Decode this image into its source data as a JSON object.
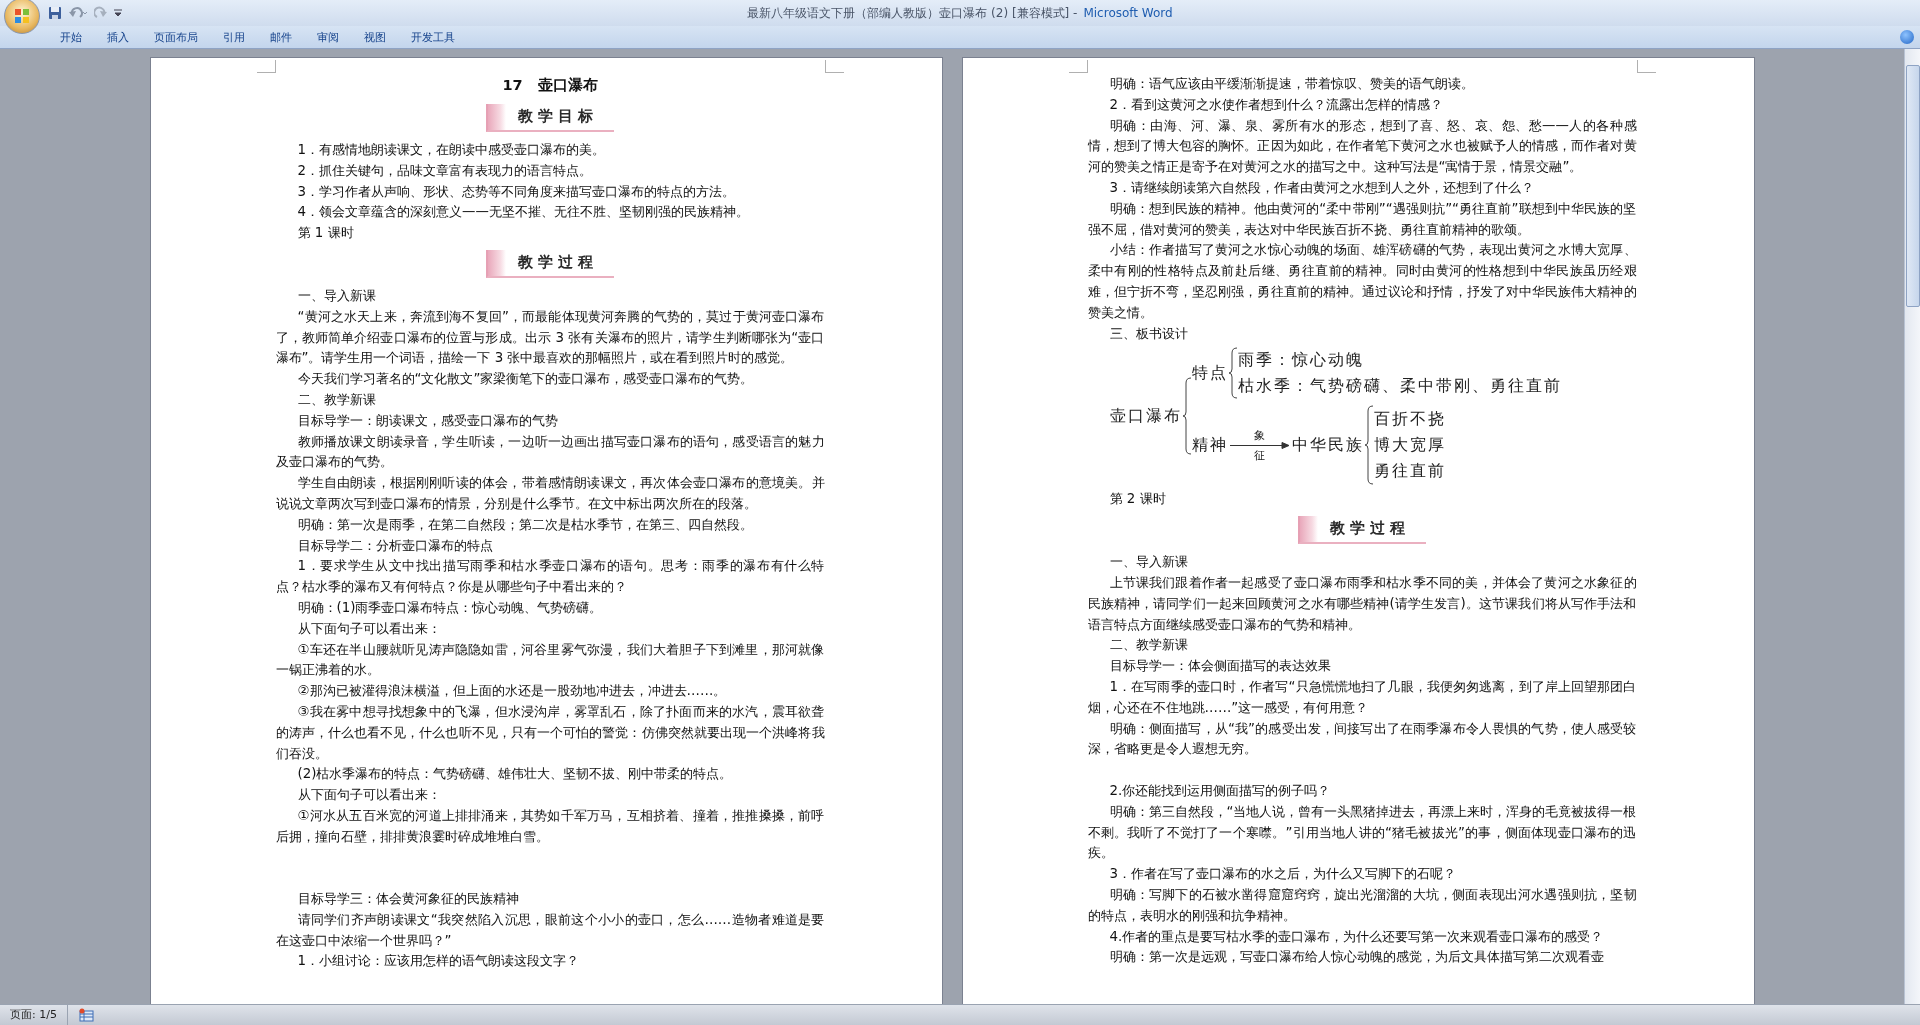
{
  "window": {
    "title": "最新八年级语文下册（部编人教版）壶口瀑布 (2) [兼容模式] -",
    "app_name": "Microsoft Word"
  },
  "ribbon_tabs": [
    {
      "label": "开始",
      "selected": false
    },
    {
      "label": "插入",
      "selected": false
    },
    {
      "label": "页面布局",
      "selected": false
    },
    {
      "label": "引用",
      "selected": false
    },
    {
      "label": "邮件",
      "selected": false
    },
    {
      "label": "审阅",
      "selected": false
    },
    {
      "label": "视图",
      "selected": false
    },
    {
      "label": "开发工具",
      "selected": false
    }
  ],
  "pages": [
    {
      "blocks": [
        {
          "kind": "title",
          "text": "17　壶口瀑布"
        },
        {
          "kind": "banner",
          "text": "教学目标"
        },
        {
          "kind": "para",
          "text": "1．有感情地朗读课文，在朗读中感受壶口瀑布的美。"
        },
        {
          "kind": "para",
          "text": "2．抓住关键句，品味文章富有表现力的语言特点。"
        },
        {
          "kind": "para",
          "text": "3．学习作者从声响、形状、态势等不同角度来描写壶口瀑布的特点的方法。"
        },
        {
          "kind": "para",
          "text": "4．领会文章蕴含的深刻意义——无坚不摧、无往不胜、坚韧刚强的民族精神。"
        },
        {
          "kind": "para",
          "text": "第 1 课时"
        },
        {
          "kind": "banner",
          "text": "教学过程"
        },
        {
          "kind": "para",
          "text": "一、导入新课"
        },
        {
          "kind": "para",
          "text": "“黄河之水天上来，奔流到海不复回”，而最能体现黄河奔腾的气势的，莫过于黄河壶口瀑布了，教师简单介绍壶口瀑布的位置与形成。出示 3 张有关瀑布的照片，请学生判断哪张为“壶口瀑布”。请学生用一个词语，描绘一下 3 张中最喜欢的那幅照片，或在看到照片时的感觉。"
        },
        {
          "kind": "para",
          "text": "今天我们学习著名的“文化散文”家梁衡笔下的壶口瀑布，感受壶口瀑布的气势。"
        },
        {
          "kind": "para",
          "text": "二、教学新课"
        },
        {
          "kind": "para",
          "text": "目标导学一：朗读课文，感受壶口瀑布的气势"
        },
        {
          "kind": "para",
          "text": "教师播放课文朗读录音，学生听读，一边听一边画出描写壶口瀑布的语句，感受语言的魅力及壶口瀑布的气势。"
        },
        {
          "kind": "para",
          "text": "学生自由朗读，根据刚刚听读的体会，带着感情朗读课文，再次体会壶口瀑布的意境美。并说说文章两次写到壶口瀑布的情景，分别是什么季节。在文中标出两次所在的段落。"
        },
        {
          "kind": "para",
          "text": "明确：第一次是雨季，在第二自然段；第二次是枯水季节，在第三、四自然段。"
        },
        {
          "kind": "para",
          "text": "目标导学二：分析壶口瀑布的特点"
        },
        {
          "kind": "para",
          "text": "1．要求学生从文中找出描写雨季和枯水季壶口瀑布的语句。思考：雨季的瀑布有什么特点？枯水季的瀑布又有何特点？你是从哪些句子中看出来的？"
        },
        {
          "kind": "para",
          "text": "明确：(1)雨季壶口瀑布特点：惊心动魄、气势磅礴。"
        },
        {
          "kind": "para",
          "text": "从下面句子可以看出来："
        },
        {
          "kind": "para",
          "text": "①车还在半山腰就听见涛声隐隐如雷，河谷里雾气弥漫，我们大着胆子下到滩里，那河就像一锅正沸着的水。"
        },
        {
          "kind": "para",
          "text": "②那沟已被灌得浪沫横溢，但上面的水还是一股劲地冲进去，冲进去……。"
        },
        {
          "kind": "para",
          "text": "③我在雾中想寻找想象中的飞瀑，但水浸沟岸，雾罩乱石，除了扑面而来的水汽，震耳欲聋的涛声，什么也看不见，什么也听不见，只有一个可怕的警觉：仿佛突然就要出现一个洪峰将我们吞没。"
        },
        {
          "kind": "para",
          "text": "(2)枯水季瀑布的特点：气势磅礴、雄伟壮大、坚韧不拔、刚中带柔的特点。"
        },
        {
          "kind": "para",
          "text": "从下面句子可以看出来："
        },
        {
          "kind": "para",
          "text": "①河水从五百米宽的河道上排排涌来，其势如千军万马，互相挤着、撞着，推推搡搡，前呼后拥，撞向石壁，排排黄浪霎时碎成堆堆白雪。"
        },
        {
          "kind": "blank"
        },
        {
          "kind": "blank"
        },
        {
          "kind": "para",
          "text": "目标导学三：体会黄河象征的民族精神"
        },
        {
          "kind": "para",
          "text": "请同学们齐声朗读课文“我突然陷入沉思，眼前这个小小的壶口，怎么……造物者难道是要在这壶口中浓缩一个世界吗？”"
        },
        {
          "kind": "para",
          "text": "1．小组讨论：应该用怎样的语气朗读这段文字？"
        }
      ]
    },
    {
      "blocks": [
        {
          "kind": "para",
          "text": "明确：语气应该由平缓渐渐提速，带着惊叹、赞美的语气朗读。"
        },
        {
          "kind": "para",
          "text": "2．看到这黄河之水使作者想到什么？流露出怎样的情感？"
        },
        {
          "kind": "para",
          "text": "明确：由海、河、瀑、泉、雾所有水的形态，想到了喜、怒、哀、怨、愁——人的各种感情，想到了博大包容的胸怀。正因为如此，在作者笔下黄河之水也被赋予人的情感，而作者对黄河的赞美之情正是寄予在对黄河之水的描写之中。这种写法是“寓情于景，情景交融”。"
        },
        {
          "kind": "para",
          "text": "3．请继续朗读第六自然段，作者由黄河之水想到人之外，还想到了什么？"
        },
        {
          "kind": "para",
          "text": "明确：想到民族的精神。他由黄河的“柔中带刚”“遇强则抗”“勇往直前”联想到中华民族的坚强不屈，借对黄河的赞美，表达对中华民族百折不挠、勇往直前精神的歌颂。"
        },
        {
          "kind": "para",
          "text": "小结：作者描写了黄河之水惊心动魄的场面、雄浑磅礴的气势，表现出黄河之水博大宽厚、柔中有刚的性格特点及前赴后继、勇往直前的精神。同时由黄河的性格想到中华民族虽历经艰难，但宁折不弯，坚忍刚强，勇往直前的精神。通过议论和抒情，抒发了对中华民族伟大精神的赞美之情。"
        },
        {
          "kind": "para",
          "text": "三、板书设计"
        },
        {
          "kind": "diagram",
          "root": "壶口瀑布",
          "features": {
            "label": "特点",
            "items": [
              "雨季：惊心动魄",
              "枯水季：气势磅礴、柔中带刚、勇往直前"
            ]
          },
          "spirit": {
            "label": "精神",
            "arrow_top": "象",
            "arrow_bottom": "征",
            "target": "中华民族",
            "items": [
              "百折不挠",
              "博大宽厚",
              "勇往直前"
            ]
          }
        },
        {
          "kind": "para",
          "text": "第 2 课时"
        },
        {
          "kind": "banner",
          "text": "教学过程"
        },
        {
          "kind": "para",
          "text": "一、导入新课"
        },
        {
          "kind": "para",
          "text": "上节课我们跟着作者一起感受了壶口瀑布雨季和枯水季不同的美，并体会了黄河之水象征的民族精神，请同学们一起来回顾黄河之水有哪些精神(请学生发言)。这节课我们将从写作手法和语言特点方面继续感受壶口瀑布的气势和精神。"
        },
        {
          "kind": "para",
          "text": "二、教学新课"
        },
        {
          "kind": "para",
          "text": "目标导学一：体会侧面描写的表达效果"
        },
        {
          "kind": "para",
          "text": "1．在写雨季的壶口时，作者写“只急慌慌地扫了几眼，我便匆匆逃离，到了岸上回望那团白烟，心还在不住地跳……”这一感受，有何用意？"
        },
        {
          "kind": "para",
          "text": "明确：侧面描写，从“我”的感受出发，间接写出了在雨季瀑布令人畏惧的气势，使人感受较深，省略更是令人遐想无穷。"
        },
        {
          "kind": "blank"
        },
        {
          "kind": "para",
          "text": "2.你还能找到运用侧面描写的例子吗？"
        },
        {
          "kind": "para",
          "text": "明确：第三自然段，“当地人说，曾有一头黑猪掉进去，再漂上来时，浑身的毛竟被拔得一根不剩。我听了不觉打了一个寒噤。”引用当地人讲的“猪毛被拔光”的事，侧面体现壶口瀑布的迅疾。"
        },
        {
          "kind": "para",
          "text": "3．作者在写了壶口瀑布的水之后，为什么又写脚下的石呢？"
        },
        {
          "kind": "para",
          "text": "明确：写脚下的石被水凿得窟窟窍窍，旋出光溜溜的大坑，侧面表现出河水遇强则抗，坚韧的特点，表明水的刚强和抗争精神。"
        },
        {
          "kind": "para",
          "text": "4.作者的重点是要写枯水季的壶口瀑布，为什么还要写第一次来观看壶口瀑布的感受？"
        },
        {
          "kind": "para",
          "text": "明确：第一次是远观，写壶口瀑布给人惊心动魄的感觉，为后文具体描写第二次观看壶"
        }
      ]
    }
  ],
  "status_bar": {
    "page": "页面: 1/5"
  }
}
